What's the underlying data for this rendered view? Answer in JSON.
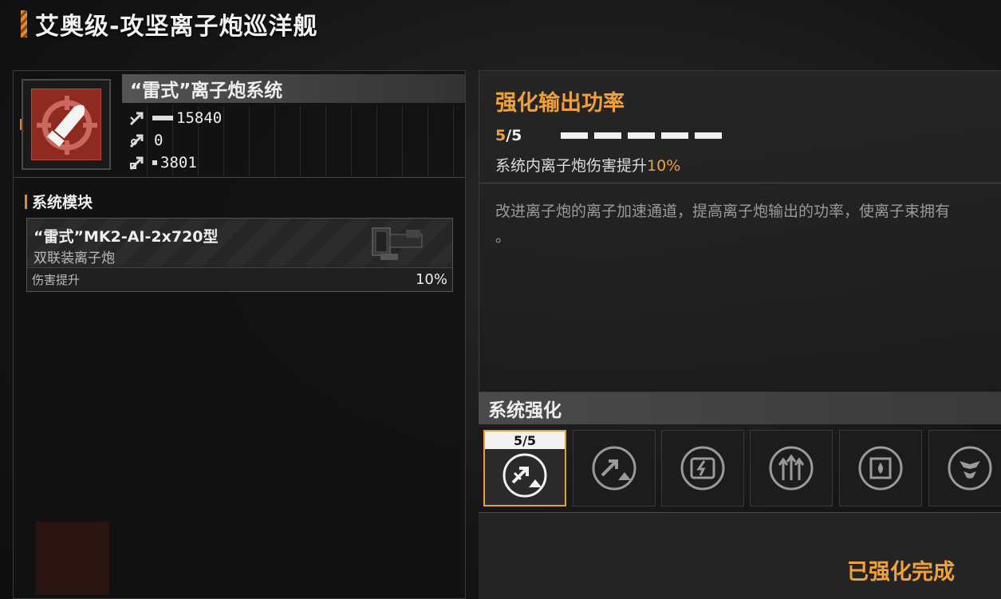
{
  "page_title": "艾奥级-攻坚离子炮巡洋舰",
  "system": {
    "name": "“雷式”离子炮系统",
    "icon": "bullet-target-icon",
    "stats": [
      {
        "icon": "stat-damage-icon",
        "value": "15840",
        "bar_fraction": 1.0
      },
      {
        "icon": "stat-antiair-icon",
        "value": "0",
        "bar_fraction": 0.0
      },
      {
        "icon": "stat-siege-icon",
        "value": "3801",
        "bar_fraction": 0.24
      }
    ]
  },
  "modules": {
    "label": "系统模块",
    "items": [
      {
        "name": "“雷式”MK2-AI-2x720型",
        "type": "双联装离子炮",
        "stat_label": "伤害提升",
        "stat_value": "10%"
      }
    ]
  },
  "upgrade": {
    "title": "强化输出功率",
    "level_current": "5",
    "level_max": "/5",
    "pips_filled": 5,
    "pips_total": 5,
    "effect_prefix": "系统内离子炮伤害提升",
    "effect_value": "10%",
    "description_line1": "改进离子炮的离子加速通道，提高离子炮输出的功率，使离子束拥有",
    "description_line2": "。"
  },
  "enhancement": {
    "header": "系统强化",
    "slots": [
      {
        "icon": "damage-up-icon",
        "badge": "5/5",
        "active": true
      },
      {
        "icon": "damage-up-icon",
        "active": false
      },
      {
        "icon": "energy-card-icon",
        "active": false
      },
      {
        "icon": "triple-arrow-up-icon",
        "active": false
      },
      {
        "icon": "chip-fire-icon",
        "active": false
      },
      {
        "icon": "shield-emblem-icon",
        "active": false
      }
    ],
    "status": "已强化完成"
  },
  "colors": {
    "accent": "#f0a13a",
    "system_icon_bg": "#8e2a20"
  }
}
